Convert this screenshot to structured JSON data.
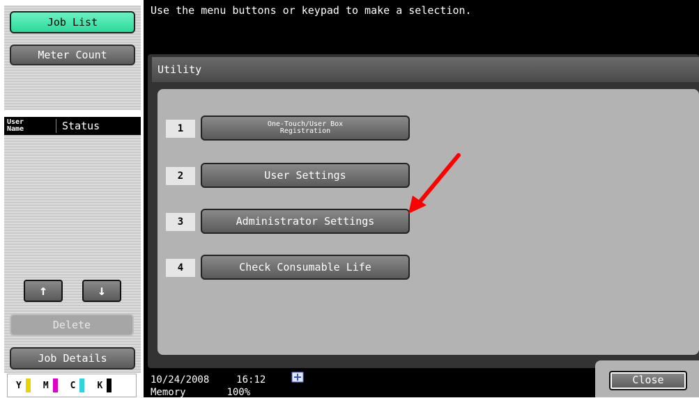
{
  "sidebar": {
    "job_list_label": "Job List",
    "meter_count_label": "Meter Count",
    "columns": {
      "user_name": "User\nName",
      "status": "Status"
    },
    "up_icon": "arrow-up-icon",
    "down_icon": "arrow-down-icon",
    "up_glyph": "↑",
    "down_glyph": "↓",
    "delete_label": "Delete",
    "job_details_label": "Job Details",
    "toner": [
      {
        "letter": "Y",
        "color": "#e8d400"
      },
      {
        "letter": "M",
        "color": "#e000c8"
      },
      {
        "letter": "C",
        "color": "#2fd4e0"
      },
      {
        "letter": "K",
        "color": "#000000"
      }
    ]
  },
  "header": {
    "message": "Use the menu buttons or keypad to make a selection."
  },
  "panel": {
    "title": "Utility",
    "items": [
      {
        "number": "1",
        "label": "One-Touch/User Box\nRegistration"
      },
      {
        "number": "2",
        "label": "User Settings"
      },
      {
        "number": "3",
        "label": "Administrator Settings"
      },
      {
        "number": "4",
        "label": "Check Consumable Life"
      }
    ]
  },
  "status": {
    "date": "10/24/2008",
    "time": "16:12",
    "memory_label": "Memory",
    "memory_value": "100%"
  },
  "close_label": "Close",
  "annotation": {
    "arrow_color": "#ff0000"
  }
}
